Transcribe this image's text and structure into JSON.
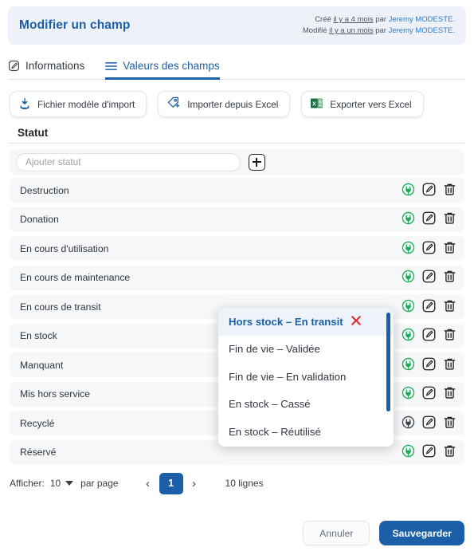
{
  "header": {
    "title": "Modifier un champ",
    "created_prefix": "Créé ",
    "created_rel": "il y a 4 mois",
    "created_mid": " par ",
    "created_user": "Jeremy MODESTE.",
    "modified_prefix": "Modifié ",
    "modified_rel": "il y a un mois",
    "modified_mid": " par ",
    "modified_user": "Jeremy MODESTE.",
    "bg_color": "#eef2f8",
    "title_color": "#1b5fa8"
  },
  "tabs": [
    {
      "label": "Informations",
      "icon": "edit-square-icon",
      "active": false
    },
    {
      "label": "Valeurs des champs",
      "icon": "list-lines-icon",
      "active": true
    }
  ],
  "toolbar": {
    "buttons": [
      {
        "label": "Fichier modèle d'import",
        "icon": "download-icon"
      },
      {
        "label": "Importer depuis Excel",
        "icon": "tag-plus-icon"
      },
      {
        "label": "Exporter vers Excel",
        "icon": "excel-icon"
      }
    ]
  },
  "section": {
    "title": "Statut"
  },
  "add": {
    "placeholder": "Ajouter statut",
    "value": "",
    "add_button_icon": "plus-icon"
  },
  "list": {
    "row_actions": [
      "plug-status-icon",
      "edit-icon",
      "delete-icon"
    ],
    "items": [
      {
        "label": "Destruction"
      },
      {
        "label": "Donation"
      },
      {
        "label": "En cours d'utilisation"
      },
      {
        "label": "En cours de maintenance"
      },
      {
        "label": "En cours de transit"
      },
      {
        "label": "En stock"
      },
      {
        "label": "Manquant"
      },
      {
        "label": "Mis hors service"
      },
      {
        "label": "Recyclé"
      },
      {
        "label": "Réservé"
      }
    ]
  },
  "dropdown": {
    "items": [
      {
        "label": "Hors stock – En transit",
        "selected": true,
        "clear_icon": "close-x-icon"
      },
      {
        "label": "Fin de vie – Validée",
        "selected": false
      },
      {
        "label": "Fin de vie – En validation",
        "selected": false
      },
      {
        "label": "En stock – Cassé",
        "selected": false
      },
      {
        "label": "En stock – Réutilisé",
        "selected": false
      }
    ],
    "scrollbar_color": "#1b5fa8"
  },
  "pagination": {
    "show_label": "Afficher:",
    "per_page_value": "10",
    "per_page_suffix": "par page",
    "prev_icon": "chevron-left-icon",
    "next_icon": "chevron-right-icon",
    "current_page": "1",
    "rows_total": "10 lignes"
  },
  "footer": {
    "cancel_label": "Annuler",
    "save_label": "Sauvegarder",
    "save_color": "#1b5fa8"
  }
}
